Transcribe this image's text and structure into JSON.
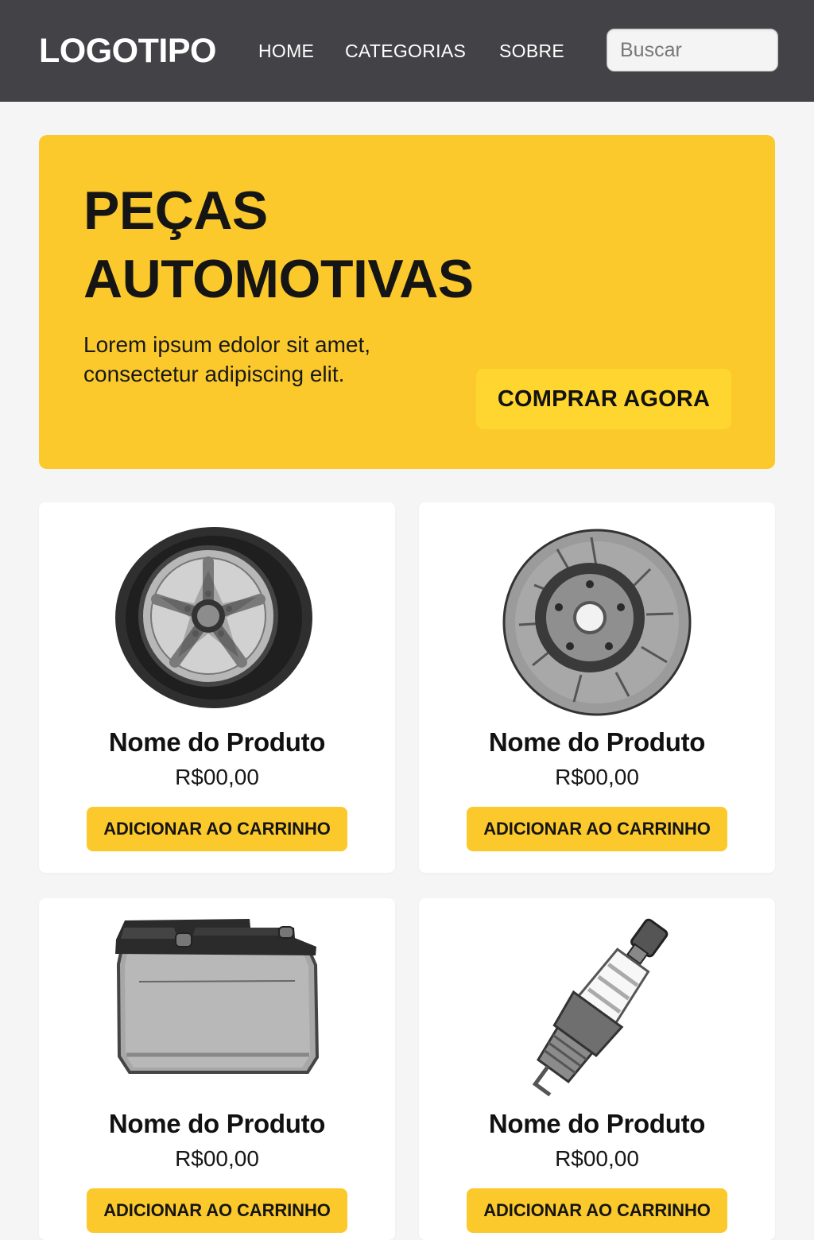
{
  "header": {
    "logo": "LOGOTIPO",
    "nav": [
      {
        "label": "HOME"
      },
      {
        "label": "CATEGORIAS"
      },
      {
        "label": "SOBRE"
      }
    ],
    "search": {
      "placeholder": "Buscar",
      "value": ""
    }
  },
  "hero": {
    "title_lines": [
      "PEÇAS",
      "AUTOMOTIVAS"
    ],
    "subtitle_lines": [
      "Lorem ipsum edolor sit amet,",
      "consectetur adipiscing elit."
    ],
    "cta_label": "COMPRAR AGORA"
  },
  "products": [
    {
      "name": "Nome do Produto",
      "price": "R$00,00",
      "button_label": "ADICIONAR AO CARRINHO",
      "image_icon": "wheel-icon"
    },
    {
      "name": "Nome do Produto",
      "price": "R$00,00",
      "button_label": "ADICIONAR AO CARRINHO",
      "image_icon": "brake-disc-icon"
    },
    {
      "name": "Nome do Produto",
      "price": "R$00,00",
      "button_label": "ADICIONAR AO CARRINHO",
      "image_icon": "battery-icon"
    },
    {
      "name": "Nome do Produto",
      "price": "R$00,00",
      "button_label": "ADICIONAR AO CARRINHO",
      "image_icon": "spark-plug-icon"
    }
  ],
  "colors": {
    "header_background": "#434347",
    "page_background": "#f5f5f5",
    "accent_yellow": "#fbc92b",
    "card_background": "#ffffff",
    "text_dark": "#151515"
  }
}
